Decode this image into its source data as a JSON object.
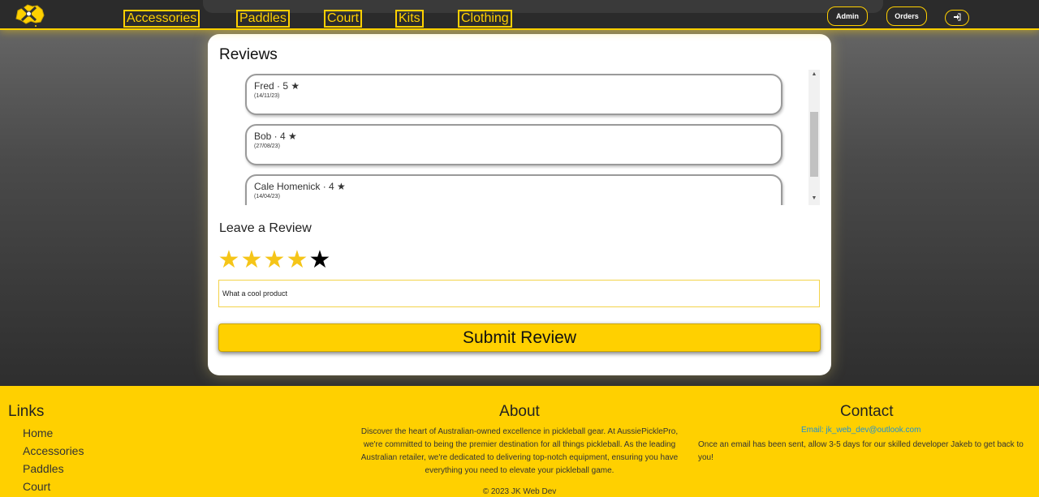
{
  "nav": {
    "links": [
      "Accessories",
      "Paddles",
      "Court",
      "Kits",
      "Clothing"
    ],
    "admin_label": "Admin",
    "orders_label": "Orders",
    "login_icon": "sign-in-icon",
    "logo_icon": "australia-pickleball-logo"
  },
  "reviews": {
    "title": "Reviews",
    "items": [
      {
        "header": "Fred · 5 ★",
        "date": "(14/11/23)"
      },
      {
        "header": "Bob · 4 ★",
        "date": "(27/08/23)"
      },
      {
        "header": "Cale Homenick · 4 ★",
        "date": "(14/04/23)"
      }
    ]
  },
  "leave_review": {
    "title": "Leave a Review",
    "rating": 4,
    "max_rating": 5,
    "input_value": "What a cool product",
    "submit_label": "Submit Review"
  },
  "footer": {
    "links_title": "Links",
    "links": [
      "Home",
      "Accessories",
      "Paddles",
      "Court"
    ],
    "about_title": "About",
    "about_text": "Discover the heart of Australian-owned excellence in pickleball gear. At AussiePicklePro, we're committed to being the premier destination for all things pickleball. As the leading Australian retailer, we're dedicated to delivering top-notch equipment, ensuring you have everything you need to elevate your pickleball game.",
    "copyright": "© 2023 JK Web Dev",
    "contact_title": "Contact",
    "email": "Email: jk_web_dev@outlook.com",
    "contact_text": "Once an email has been sent, allow 3-5 days for our skilled developer Jakeb to get back to you!"
  },
  "colors": {
    "accent": "#ffd000",
    "star_on": "#f5c518",
    "nav_bg": "#2b2b2b"
  }
}
